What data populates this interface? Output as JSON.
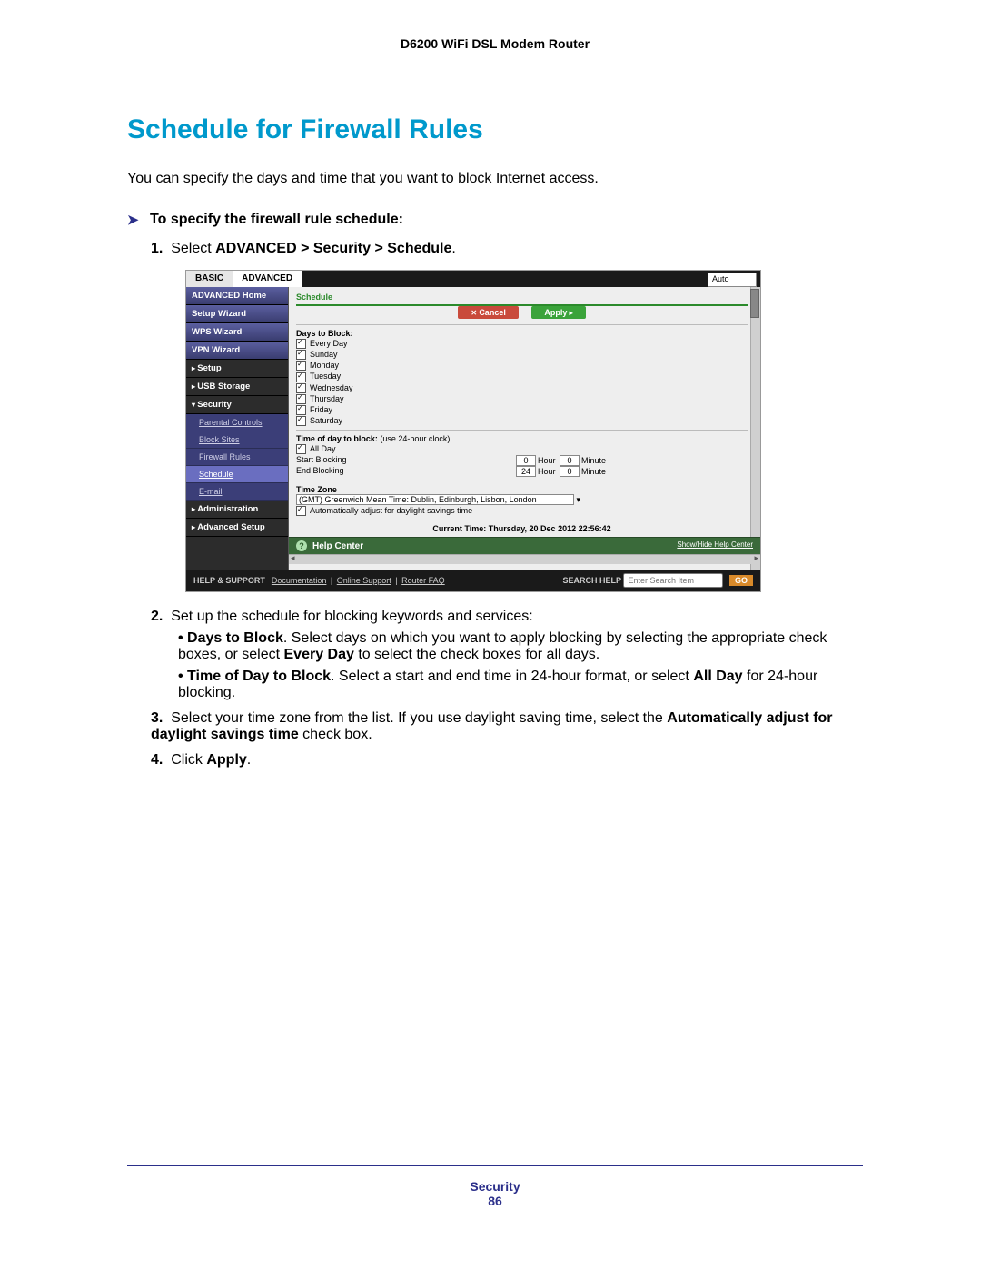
{
  "header": {
    "product": "D6200 WiFi DSL Modem Router"
  },
  "title": "Schedule for Firewall Rules",
  "intro": "You can specify the days and time that you want to block Internet access.",
  "task_heading": "To specify the firewall rule schedule:",
  "steps": {
    "s1_a": "Select ",
    "s1_b": "ADVANCED > Security > Schedule",
    "s1_c": ".",
    "s2": "Set up the schedule for blocking keywords and services:",
    "s2_b1_a": "Days to Block",
    "s2_b1_b": ". Select days on which you want to apply blocking by selecting the appropriate check boxes, or select ",
    "s2_b1_c": "Every Day",
    "s2_b1_d": " to select the check boxes for all days.",
    "s2_b2_a": "Time of Day to Block",
    "s2_b2_b": ". Select a start and end time in 24-hour format, or select ",
    "s2_b2_c": "All Day",
    "s2_b2_d": " for 24-hour blocking.",
    "s3_a": "Select your time zone from the list. If you use daylight saving time, select the ",
    "s3_b": "Automatically adjust for daylight savings time",
    "s3_c": " check box.",
    "s4_a": "Click ",
    "s4_b": "Apply",
    "s4_c": "."
  },
  "shot": {
    "tabs": {
      "basic": "BASIC",
      "advanced": "ADVANCED",
      "auto": "Auto"
    },
    "nav": {
      "adv_home": "ADVANCED Home",
      "setup_wiz": "Setup Wizard",
      "wps_wiz": "WPS Wizard",
      "vpn_wiz": "VPN Wizard",
      "setup": "Setup",
      "usb": "USB Storage",
      "security": "Security",
      "sec_sub": {
        "parental": "Parental Controls",
        "block_sites": "Block Sites",
        "fw_rules": "Firewall Rules",
        "schedule": "Schedule",
        "email": "E-mail"
      },
      "admin": "Administration",
      "adv_setup": "Advanced Setup"
    },
    "panel": {
      "title": "Schedule",
      "cancel": "Cancel",
      "apply": "Apply",
      "days_head": "Days to Block:",
      "days": {
        "every": "Every Day",
        "sun": "Sunday",
        "mon": "Monday",
        "tue": "Tuesday",
        "wed": "Wednesday",
        "thu": "Thursday",
        "fri": "Friday",
        "sat": "Saturday"
      },
      "tod_head_a": "Time of day to block:",
      "tod_head_b": "(use 24-hour clock)",
      "allday": "All Day",
      "start": "Start Blocking",
      "end": "End Blocking",
      "hour": "Hour",
      "minute": "Minute",
      "start_h": "0",
      "start_m": "0",
      "end_h": "24",
      "end_m": "0",
      "tz_head": "Time Zone",
      "tz_value": "(GMT) Greenwich Mean Time: Dublin, Edinburgh, Lisbon, London",
      "dst": "Automatically adjust for daylight savings time",
      "current_time": "Current Time: Thursday, 20 Dec 2012 22:56:42",
      "help_center": "Help Center",
      "help_toggle": "Show/Hide Help Center"
    },
    "footer": {
      "help_support": "HELP & SUPPORT",
      "doc": "Documentation",
      "online": "Online Support",
      "faq": "Router FAQ",
      "search_label": "SEARCH HELP",
      "search_placeholder": "Enter Search Item",
      "go": "GO"
    }
  },
  "page_footer": {
    "section": "Security",
    "page_no": "86"
  }
}
